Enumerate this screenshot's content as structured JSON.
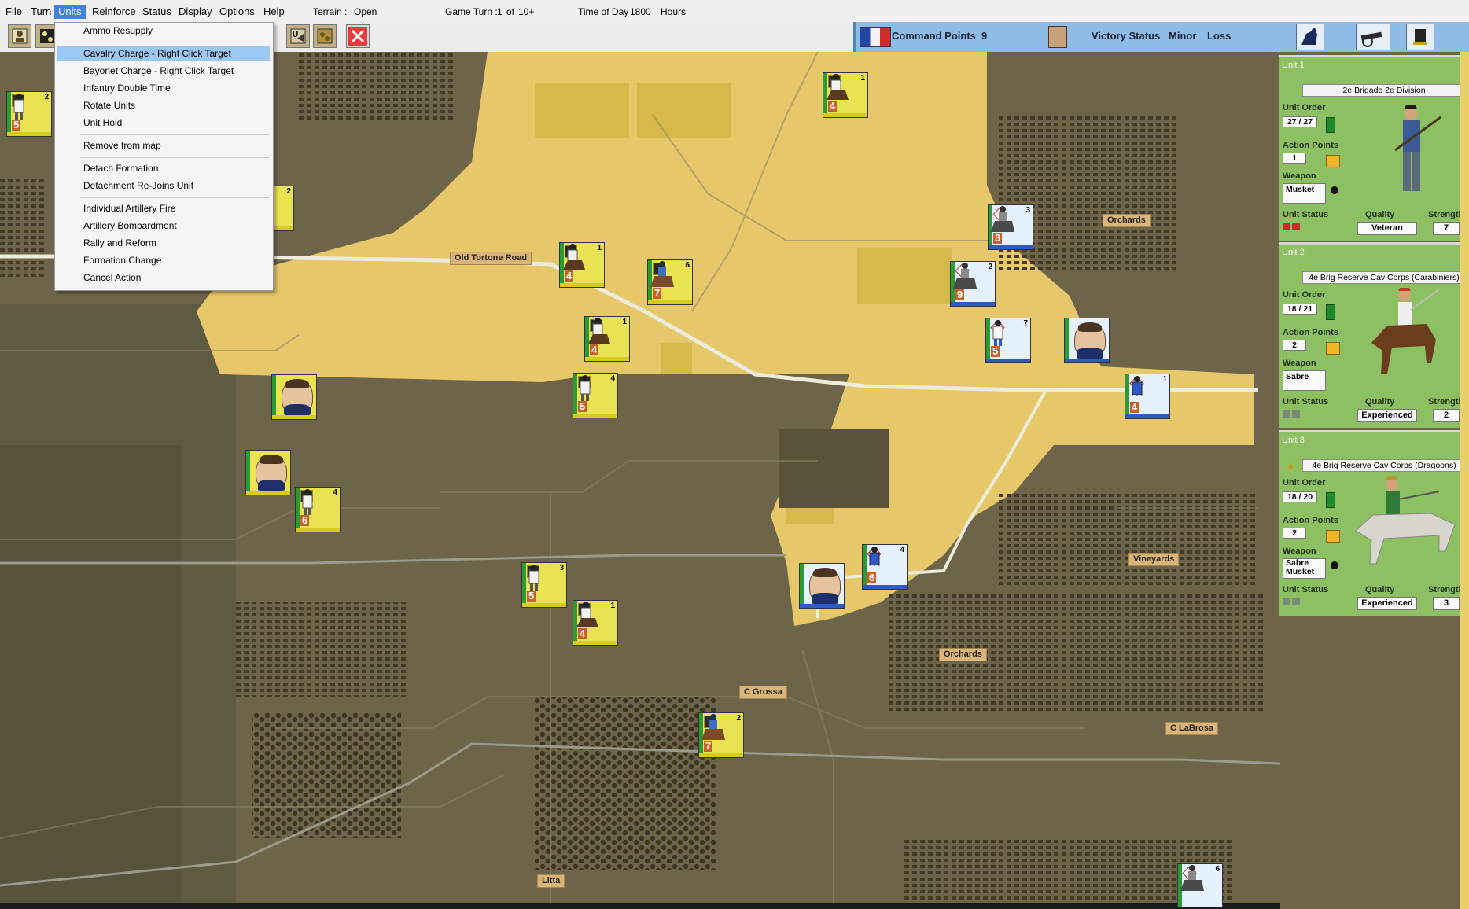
{
  "menu": {
    "items": [
      "File",
      "Turn",
      "Units",
      "Reinforce",
      "Status",
      "Display",
      "Options",
      "Help"
    ],
    "active": "Units"
  },
  "status": {
    "terrain_label": "Terrain :",
    "terrain_value": "Open",
    "turn_label": "Game Turn :",
    "turn_value": "1",
    "turn_of": "of",
    "turn_max": "10+",
    "time_label": "Time of Day",
    "time_value": "1800",
    "time_unit": "Hours"
  },
  "command": {
    "label": "Command Points",
    "value": "9",
    "victory_label": "Victory Status",
    "victory_level": "Minor",
    "victory_result": "Loss"
  },
  "units_menu": {
    "items": [
      {
        "label": "Ammo Resupply"
      },
      {
        "label": "Cavalry Charge - Right Click Target",
        "selected": true
      },
      {
        "label": "Bayonet Charge - Right Click Target"
      },
      {
        "label": "Infantry Double Time"
      },
      {
        "label": "Rotate Units"
      },
      {
        "label": "Unit Hold"
      },
      {
        "label": "Remove from map"
      },
      {
        "label": "Detach Formation"
      },
      {
        "label": "Detachment Re-Joins Unit"
      },
      {
        "label": "Individual Artillery Fire"
      },
      {
        "label": "Artillery Bombardment"
      },
      {
        "label": "Rally and Reform"
      },
      {
        "label": "Formation Change"
      },
      {
        "label": "Cancel Action"
      }
    ]
  },
  "map_labels": [
    "Old Tortone Road",
    "Orchards",
    "Vineyards",
    "Orchards",
    "C Grossa",
    "C LaBrosa",
    "Litta"
  ],
  "counters": [
    {
      "side": "austrian",
      "num": "2",
      "str": "5"
    },
    {
      "side": "austrian",
      "num": "2",
      "str": ""
    },
    {
      "side": "austrian",
      "num": "1",
      "str": "4"
    },
    {
      "side": "austrian",
      "num": "1",
      "str": "4"
    },
    {
      "side": "austrian",
      "num": "6",
      "str": "7"
    },
    {
      "side": "austrian",
      "num": "1",
      "str": "4"
    },
    {
      "side": "austrian",
      "num": "4",
      "str": "5"
    },
    {
      "side": "austrian",
      "num": "4",
      "str": "6"
    },
    {
      "side": "austrian",
      "num": "3",
      "str": "5"
    },
    {
      "side": "austrian",
      "num": "1",
      "str": "4"
    },
    {
      "side": "austrian",
      "num": "2",
      "str": "7"
    },
    {
      "side": "french",
      "num": "3",
      "str": "3"
    },
    {
      "side": "french",
      "num": "2",
      "str": "9"
    },
    {
      "side": "french",
      "num": "7",
      "str": "5"
    },
    {
      "side": "french",
      "num": "1",
      "str": "4"
    },
    {
      "side": "french",
      "num": "4",
      "str": "6"
    },
    {
      "side": "french",
      "num": "6",
      "str": ""
    }
  ],
  "units": [
    {
      "title": "Unit 1",
      "name": "2e Brigade 2e Division",
      "order_label": "Unit Order",
      "order": "27 / 27",
      "ap_label": "Action Points",
      "ap": "1",
      "weapon_label": "Weapon",
      "weapon": "Musket",
      "status_label": "Unit Status",
      "quality_label": "Quality",
      "quality": "Veteran",
      "strength_label": "Strength",
      "strength": "7"
    },
    {
      "title": "Unit 2",
      "name": "4e Brig Reserve Cav Corps (Carabiniers)",
      "order_label": "Unit Order",
      "order": "18 / 21",
      "ap_label": "Action Points",
      "ap": "2",
      "weapon_label": "Weapon",
      "weapon": "Sabre",
      "status_label": "Unit Status",
      "quality_label": "Quality",
      "quality": "Experienced",
      "strength_label": "Strength",
      "strength": "2"
    },
    {
      "title": "Unit 3",
      "name": "4e Brig Reserve Cav Corps (Dragoons)",
      "order_label": "Unit Order",
      "order": "18 / 20",
      "ap_label": "Action Points",
      "ap": "2",
      "weapon_label": "Weapon",
      "weapon": "Sabre",
      "weapon2": "Musket",
      "status_label": "Unit Status",
      "quality_label": "Quality",
      "quality": "Experienced",
      "strength_label": "Strength",
      "strength": "3"
    }
  ],
  "colors": {
    "menu_active": "#3f82d8",
    "command_bar": "#8fbce6",
    "panel_bg": "#8dc063",
    "map_light": "#e6c86a",
    "map_dark": "#6e6449",
    "austrian_counter": "#e9e251",
    "french_counter": "#e6f1ff"
  }
}
